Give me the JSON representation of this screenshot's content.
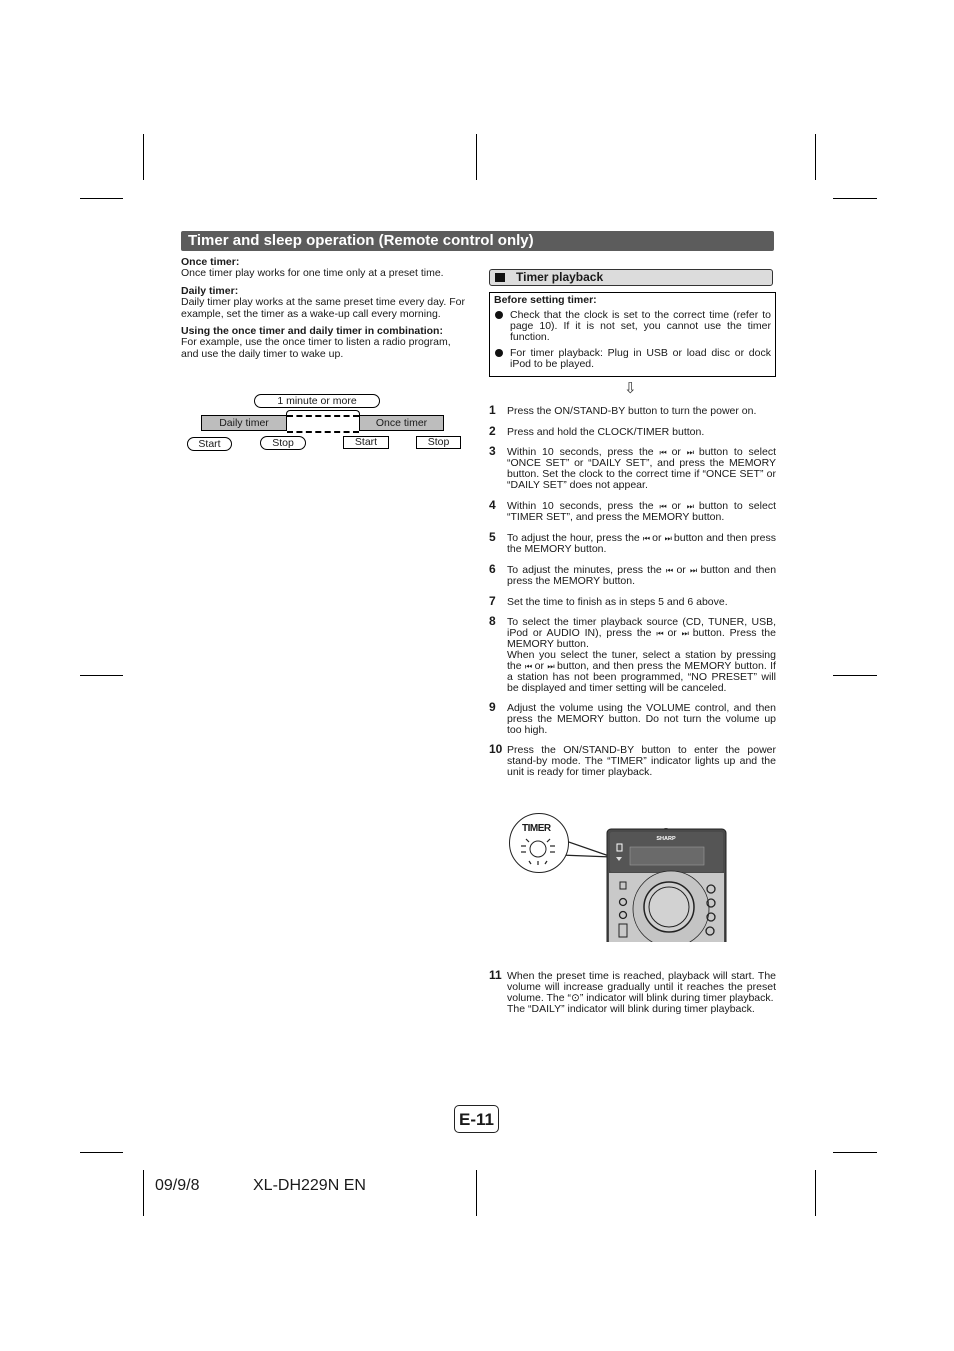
{
  "section_title": "Timer and sleep operation (Remote control only)",
  "left": {
    "once_heading": "Once timer:",
    "once_text": "Once timer play works for one time only at a preset time.",
    "daily_heading": "Daily timer:",
    "daily_text": "Daily timer play works at the same preset time every day. For example, set the timer as a wake-up call every morning.",
    "combo_heading": "Using the once timer and daily timer in combination:",
    "combo_text": "For example, use the once timer to listen a radio program, and use the daily timer to wake up."
  },
  "diagram": {
    "gap_label": "1 minute or more",
    "daily_label": "Daily timer",
    "once_label": "Once timer",
    "start1": "Start",
    "stop1": "Stop",
    "start2": "Start",
    "stop2": "Stop"
  },
  "timer_playback": {
    "title": "Timer playback",
    "before_heading": "Before setting timer:",
    "bullets": [
      "Check that the clock is set to the correct time (refer to page 10). If it is not set, you cannot use the timer function.",
      "For timer playback: Plug in USB or load disc or dock iPod to be played."
    ],
    "arrow_icon": "⇩"
  },
  "skip_icons": {
    "prev": "⏮",
    "next": "⏭"
  },
  "steps": [
    {
      "num": "1",
      "text": "Press the ON/STAND-BY button to turn the power on."
    },
    {
      "num": "2",
      "text": "Press and hold the CLOCK/TIMER button."
    },
    {
      "num": "3",
      "pre": "Within 10 seconds, press the",
      "mid": "or",
      "post": "button to select “ONCE SET” or “DAILY SET”, and press the MEMORY button. Set the clock to the correct time if “ONCE SET” or “DAILY SET” does not appear."
    },
    {
      "num": "4",
      "pre": "Within 10 seconds, press the",
      "mid": "or",
      "post": "button to select “TIMER SET”, and press the MEMORY button."
    },
    {
      "num": "5",
      "pre": "To adjust the hour, press the",
      "mid": "or",
      "post": "button and then press the MEMORY button."
    },
    {
      "num": "6",
      "pre": "To adjust the minutes, press the",
      "mid": "or",
      "post": "button and then press the MEMORY button."
    },
    {
      "num": "7",
      "text": "Set the time to finish as in steps 5 and 6 above."
    },
    {
      "num": "8",
      "pre": "To select the timer playback source (CD, TUNER, USB, iPod or AUDIO IN), press the",
      "mid": "or",
      "post": "button. Press the MEMORY button.",
      "pre2": "When you select the tuner, select a station by pressing the",
      "mid2": "or",
      "post2": "button, and then press the MEMORY button. If a station has not been programmed, “NO PRESET” will be displayed and timer setting will be canceled."
    },
    {
      "num": "9",
      "text": "Adjust the volume using the VOLUME control, and then press the MEMORY button. Do not turn the volume up too high."
    },
    {
      "num": "10",
      "text": "Press the ON/STAND-BY button to enter the power stand-by mode. The “TIMER” indicator lights up and the unit is ready for timer playback."
    },
    {
      "num": "11",
      "pre": "When the preset time is reached, playback will start. The volume will increase gradually until it reaches the preset volume. The “",
      "icon": "⊙",
      "post": "” indicator will blink during timer playback.",
      "line2": "The “DAILY” indicator will blink during timer playback."
    }
  ],
  "illustration": {
    "callout_label": "TIMER",
    "brand": "SHARP"
  },
  "page_number": "E-11",
  "footer": {
    "date": "09/9/8",
    "model": "XL-DH229N EN"
  }
}
